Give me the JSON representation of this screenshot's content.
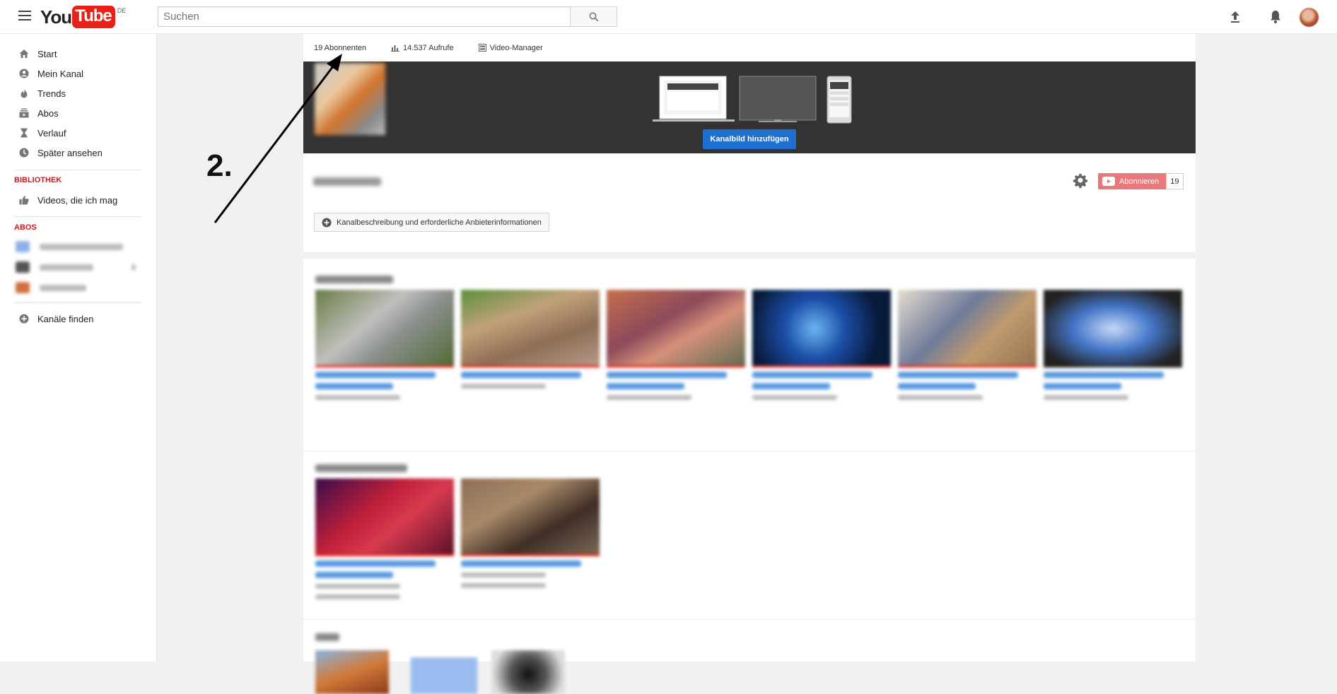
{
  "header": {
    "logo_you": "You",
    "logo_tube": "Tube",
    "region": "DE",
    "search_placeholder": "Suchen",
    "icons": [
      "menu-icon",
      "search-icon",
      "upload-icon",
      "bell-icon"
    ]
  },
  "sidebar": {
    "items": [
      {
        "label": "Start",
        "icon": "home-icon"
      },
      {
        "label": "Mein Kanal",
        "icon": "account-icon"
      },
      {
        "label": "Trends",
        "icon": "flame-icon"
      },
      {
        "label": "Abos",
        "icon": "subscriptions-icon"
      },
      {
        "label": "Verlauf",
        "icon": "hourglass-icon"
      },
      {
        "label": "Später ansehen",
        "icon": "clock-icon"
      }
    ],
    "library_heading": "BIBLIOTHEK",
    "library_items": [
      {
        "label": "Videos, die ich mag",
        "icon": "thumbs-up-icon"
      }
    ],
    "abos_heading": "ABOS",
    "find_channels": "Kanäle finden"
  },
  "channel": {
    "subscribers": "19 Abonnenten",
    "views": "14.537 Aufrufe",
    "video_manager": "Video-Manager",
    "add_channel_art": "Kanalbild hinzufügen",
    "subscribe_label": "Abonnieren",
    "subscribe_count": "19",
    "description_button": "Kanalbeschreibung und erforderliche Anbieterinformationen"
  },
  "annotation": {
    "label": "2."
  },
  "colors": {
    "brand_red": "#e62117",
    "primary_blue": "#1f6fd0",
    "banner_dark": "#333333",
    "subscribe_red": "#e9787b"
  }
}
